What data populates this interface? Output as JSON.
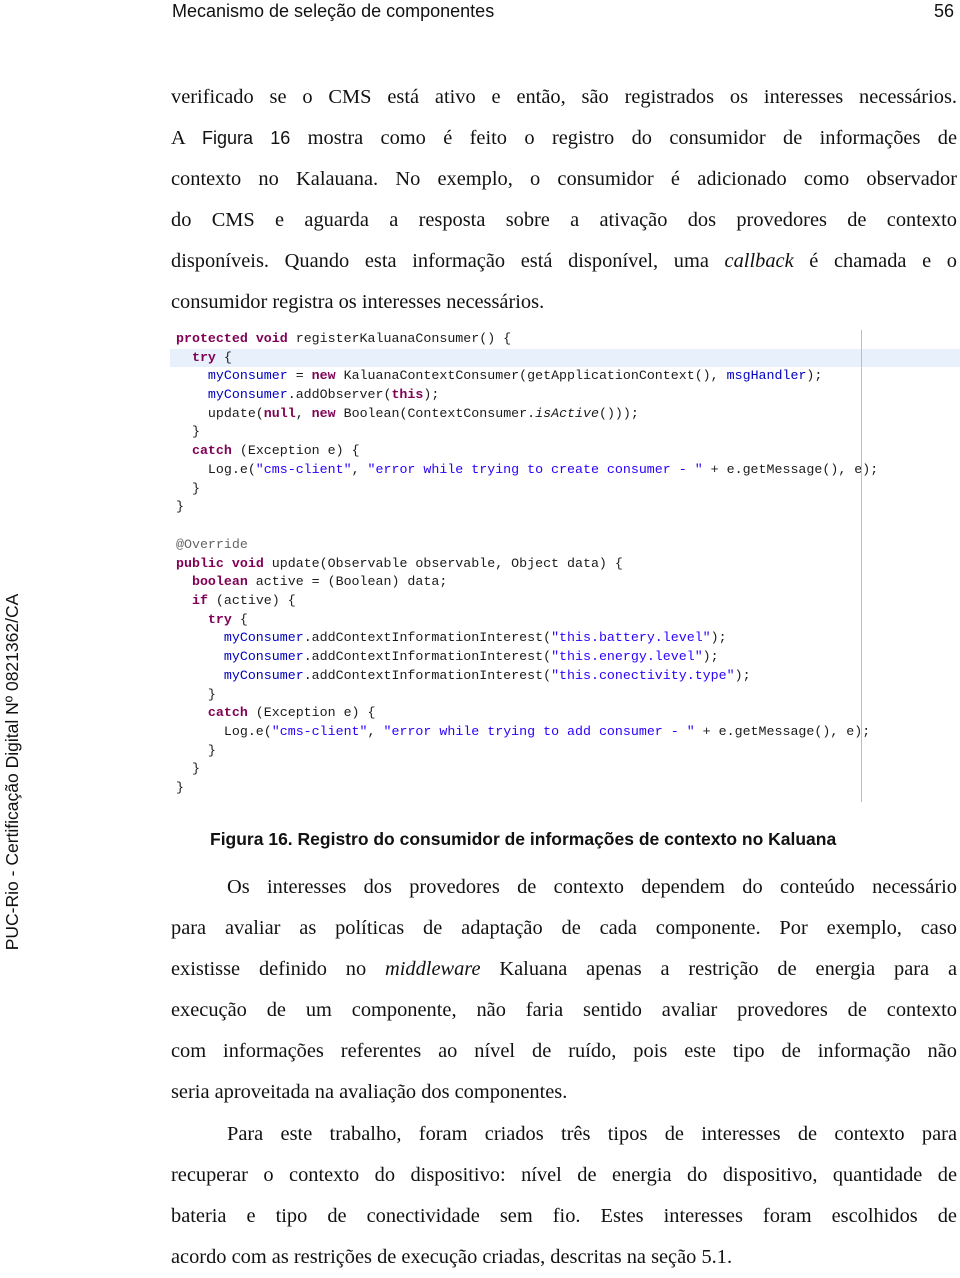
{
  "header": {
    "chapter_title": "Mecanismo de seleção de componentes",
    "page_number": "56"
  },
  "side_stamp": "PUC-Rio - Certificação Digital Nº 0821362/CA",
  "paragraph1": {
    "lines": [
      "verificado se o CMS está ativo e então, são registrados os interesses necessários.",
      [
        "A ",
        "Figura 16",
        " mostra como é feito o registro do consumidor de informações de"
      ],
      "contexto no Kalauana. No exemplo, o consumidor é adicionado como observador",
      "do CMS e aguarda a resposta sobre a ativação dos provedores de contexto",
      [
        "disponíveis. Quando esta informação está disponível, uma ",
        "callback",
        " é chamada e o"
      ],
      "consumidor registra os interesses necessários."
    ]
  },
  "figure": {
    "code_block_1": [
      "protected void registerKaluanaConsumer() {",
      "  try {",
      "    myConsumer = new KaluanaContextConsumer(getApplicationContext(), msgHandler);",
      "    myConsumer.addObserver(this);",
      "    update(null, new Boolean(ContextConsumer.isActive()));",
      "  }",
      "  catch (Exception e) {",
      "    Log.e(\"cms-client\", \"error while trying to create consumer - \" + e.getMessage(), e);",
      "  }",
      "}"
    ],
    "code_block_2": [
      "@Override",
      "public void update(Observable observable, Object data) {",
      "  boolean active = (Boolean) data;",
      "  if (active) {",
      "    try {",
      "      myConsumer.addContextInformationInterest(\"this.battery.level\");",
      "      myConsumer.addContextInformationInterest(\"this.energy.level\");",
      "      myConsumer.addContextInformationInterest(\"this.conectivity.type\");",
      "    }",
      "    catch (Exception e) {",
      "      Log.e(\"cms-client\", \"error while trying to add consumer - \" + e.getMessage(), e);",
      "    }",
      "  }",
      "}"
    ],
    "caption": "Figura 16. Registro do consumidor de informações de contexto no Kaluana",
    "colors": {
      "keyword": "#7f0055",
      "field": "#0000c0",
      "string": "#2a00ff",
      "annotation": "#646464",
      "highlight_line": "#e8f0fb"
    }
  },
  "paragraph2": {
    "lines": [
      "Os interesses dos provedores de contexto dependem do conteúdo necessário",
      "para avaliar as políticas de adaptação de cada componente. Por exemplo, caso",
      [
        "existisse definido no ",
        "middleware",
        " Kaluana apenas a restrição de energia para a"
      ],
      "execução de um componente, não faria sentido avaliar provedores de contexto",
      "com informações referentes ao nível de ruído, pois este tipo de informação não",
      "seria aproveitada na avaliação dos componentes."
    ]
  },
  "paragraph3": {
    "lines": [
      "Para este trabalho, foram criados três tipos de interesses de contexto para",
      "recuperar o contexto do dispositivo: nível de energia do dispositivo, quantidade de",
      "bateria e tipo de conectividade sem fio. Estes interesses foram escolhidos de",
      "acordo com as restrições de execução criadas, descritas na seção 5.1."
    ]
  }
}
